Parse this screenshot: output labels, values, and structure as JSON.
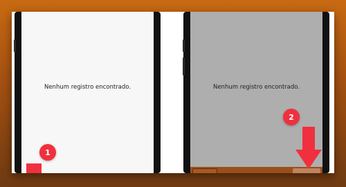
{
  "left_panel": {
    "empty_message": "Nenhum registro encontrado.",
    "step_badge": "1"
  },
  "right_panel": {
    "empty_message": "Nenhum registro encontrado.",
    "step_badge": "2"
  },
  "colors": {
    "accent": "#f0303e",
    "frame_background": "#b85e14",
    "overlay": "#aeaeae"
  }
}
